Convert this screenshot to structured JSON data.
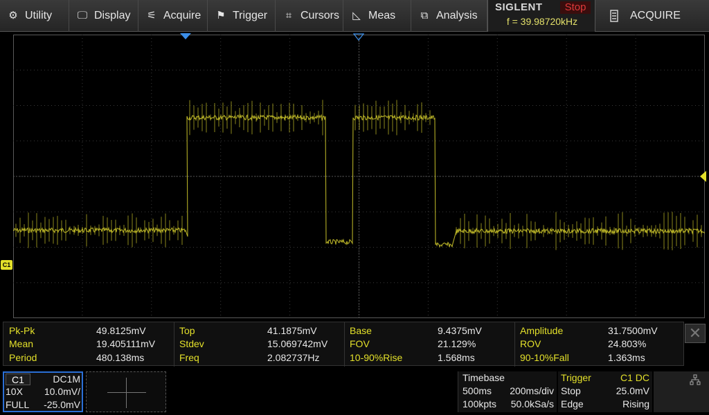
{
  "menu": [
    {
      "label": "Utility",
      "icon": "gear-icon",
      "glyph": "⚙"
    },
    {
      "label": "Display",
      "icon": "monitor-icon",
      "glyph": "🖵"
    },
    {
      "label": "Acquire",
      "icon": "acquire-icon",
      "glyph": "⚟"
    },
    {
      "label": "Trigger",
      "icon": "flag-icon",
      "glyph": "⚑"
    },
    {
      "label": "Cursors",
      "icon": "cursors-icon",
      "glyph": "⌗"
    },
    {
      "label": "Meas",
      "icon": "ruler-icon",
      "glyph": "◺"
    },
    {
      "label": "Analysis",
      "icon": "analysis-icon",
      "glyph": "⧉"
    }
  ],
  "brand": {
    "name": "SIGLENT",
    "state": "Stop",
    "freq": "f = 39.98720kHz"
  },
  "acquire_status": {
    "icon": "memory-icon",
    "label": "ACQUIRE"
  },
  "channel_tag": "C1",
  "colors": {
    "trace": "#c9c22a",
    "accent": "#e3e02a",
    "trigger_marker": "#3b8ee8"
  },
  "measurements": [
    [
      {
        "name": "Pk-Pk",
        "value": "49.8125mV"
      },
      {
        "name": "Top",
        "value": "41.1875mV"
      },
      {
        "name": "Base",
        "value": "9.4375mV"
      },
      {
        "name": "Amplitude",
        "value": "31.7500mV"
      }
    ],
    [
      {
        "name": "Mean",
        "value": "19.405111mV"
      },
      {
        "name": "Stdev",
        "value": "15.069742mV"
      },
      {
        "name": "FOV",
        "value": "21.129%"
      },
      {
        "name": "ROV",
        "value": "24.803%"
      }
    ],
    [
      {
        "name": "Period",
        "value": "480.138ms"
      },
      {
        "name": "Freq",
        "value": "2.082737Hz"
      },
      {
        "name": "10-90%Rise",
        "value": "1.568ms"
      },
      {
        "name": "90-10%Fall",
        "value": "1.363ms"
      }
    ]
  ],
  "channel": {
    "id": "C1",
    "coupling": "DC1M",
    "probe": "10X",
    "scale": "10.0mV/",
    "bandwidth": "FULL",
    "offset": "-25.0mV"
  },
  "timebase": {
    "title": "Timebase",
    "delay": "500ms",
    "scale": "200ms/div",
    "points": "100kpts",
    "rate": "50.0kSa/s"
  },
  "trigger": {
    "title": "Trigger",
    "source": "C1 DC",
    "state": "Stop",
    "level": "25.0mV",
    "type": "Edge",
    "slope": "Rising"
  }
}
